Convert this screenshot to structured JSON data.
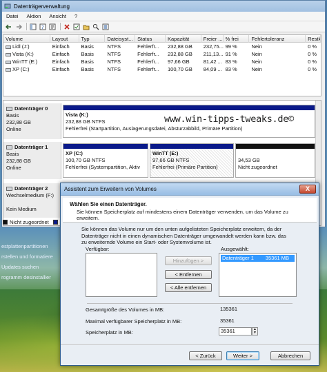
{
  "window": {
    "title": "Datenträgerverwaltung"
  },
  "menu": [
    "Datei",
    "Aktion",
    "Ansicht",
    "?"
  ],
  "volumes": {
    "columns": [
      "Volume",
      "Layout",
      "Typ",
      "Dateisyst...",
      "Status",
      "Kapazität",
      "Freier ...",
      "% frei",
      "Fehlertoleranz",
      "Restk..."
    ],
    "rows": [
      [
        "Lidl (J:)",
        "Einfach",
        "Basis",
        "NTFS",
        "Fehlerfr...",
        "232,88 GB",
        "232,75...",
        "99 %",
        "Nein",
        "0 %"
      ],
      [
        "Vista (K:)",
        "Einfach",
        "Basis",
        "NTFS",
        "Fehlerfr...",
        "232,88 GB",
        "211,13...",
        "91 %",
        "Nein",
        "0 %"
      ],
      [
        "WinTT (E:)",
        "Einfach",
        "Basis",
        "NTFS",
        "Fehlerfr...",
        "97,66 GB",
        "81,42 ...",
        "83 %",
        "Nein",
        "0 %"
      ],
      [
        "XP (C:)",
        "Einfach",
        "Basis",
        "NTFS",
        "Fehlerfr...",
        "100,70 GB",
        "84,09 ...",
        "83 %",
        "Nein",
        "0 %"
      ]
    ]
  },
  "disks": {
    "d0": {
      "name": "Datenträger 0",
      "type": "Basis",
      "size": "232,88 GB",
      "state": "Online",
      "part": {
        "name": "Vista (K:)",
        "size": "232,88 GB NTFS",
        "status": "Fehlerfrei (Startpartition, Auslagerungsdatei, Absturzabbild, Primäre Partition)"
      }
    },
    "d1": {
      "name": "Datenträger 1",
      "type": "Basis",
      "size": "232,88 GB",
      "state": "Online",
      "p1": {
        "name": "XP (C:)",
        "size": "100,70 GB NTFS",
        "status": "Fehlerfrei (Systempartition, Aktiv"
      },
      "p2": {
        "name": "WinTT (E:)",
        "size": "97,66 GB NTFS",
        "status": "Fehlerfrei (Primäre Partition)"
      },
      "p3": {
        "size": "34,53 GB",
        "status": "Nicht zugeordnet"
      }
    },
    "d2": {
      "name": "Datenträger 2",
      "type": "Wechselmedium (F:)",
      "state": "Kein Medium"
    }
  },
  "legend": {
    "unallocated": "Nicht zugeordnet",
    "primary_short": "P"
  },
  "watermark": "www.win-tipps-tweaks.de©",
  "left_pane": [
    "estplattenpartitionen",
    "rstellen und formatiere",
    "Updates suchen",
    "rogramm desinstallier"
  ],
  "wizard": {
    "title": "Assistent zum Erweitern von Volumes",
    "close": "X",
    "header_title": "Wählen Sie einen Datenträger.",
    "header_sub": "Sie können Speicherplatz auf mindestens einem Datenträger verwenden, um das Volume zu erweitern.",
    "intro": "Sie können das Volume nur um den unten aufgelisteten Speicherplatz erweitern, da der Datenträger nicht in einen dynamischen Datenträger umgewandelt werden kann bzw. das zu erweiternde Volume ein Start- oder Systemvolume ist.",
    "available_label": "Verfügbar:",
    "selected_label": "Ausgewählt:",
    "selected_item": {
      "name": "Datenträger 1",
      "size": "35361 MB"
    },
    "btn_add": "Hinzufügen >",
    "btn_remove": "< Entfernen",
    "btn_remove_all": "< Alle entfernen",
    "total_label": "Gesamtgröße des Volumes in MB:",
    "total_value": "135361",
    "max_label": "Maximal verfügbarer Speicherplatz in MB:",
    "max_value": "35361",
    "space_label": "Speicherplatz in MB:",
    "space_value": "35361",
    "btn_back": "< Zurück",
    "btn_next": "Weiter >",
    "btn_cancel": "Abbrechen"
  },
  "colors": {
    "primary_bar": "#0a1a8a",
    "unallocated_bar": "#111111",
    "title_bar": "#a2c0e1",
    "selection": "#3399ff"
  }
}
